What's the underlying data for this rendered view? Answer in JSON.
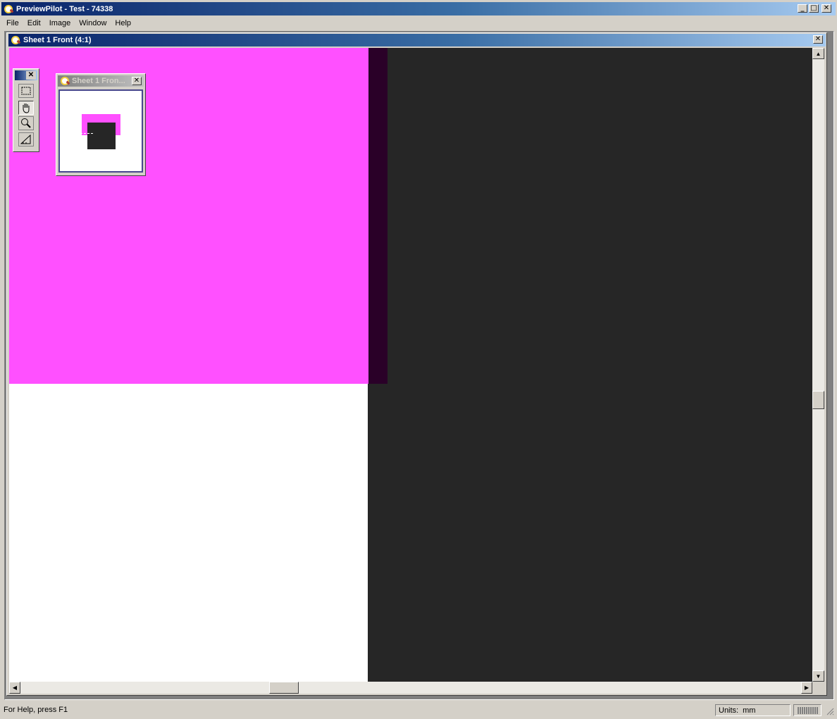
{
  "app": {
    "title": "PreviewPilot - Test - 74338",
    "icon": "magnifier-icon"
  },
  "menu": {
    "items": [
      "File",
      "Edit",
      "Image",
      "Window",
      "Help"
    ]
  },
  "document": {
    "title": "Sheet 1 Front  (4:1)",
    "colors": {
      "magenta": "#ff50ff",
      "dark_edge": "#2a0028",
      "charcoal": "#262626",
      "paper": "#ffffff"
    }
  },
  "navigator": {
    "title": "Sheet 1 Fron..."
  },
  "toolbox": {
    "tools": [
      "select-rect-icon",
      "hand-pan-icon",
      "zoom-icon",
      "measure-icon"
    ]
  },
  "statusbar": {
    "help_text": "For Help, press F1",
    "units_label": "Units:",
    "units_value": "mm"
  }
}
